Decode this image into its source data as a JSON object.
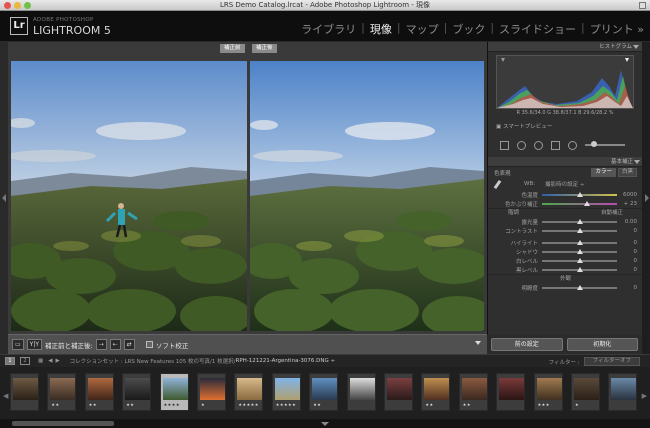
{
  "window": {
    "title": "LRS Demo Catalog.lrcat - Adobe Photoshop Lightroom - 現像"
  },
  "brand": {
    "badge": "Lr",
    "line1": "ADOBE PHOTOSHOP",
    "line2": "LIGHTROOM 5"
  },
  "modules": [
    "ライブラリ",
    "現像",
    "マップ",
    "ブック",
    "スライドショー",
    "プリント »"
  ],
  "active_module": "現像",
  "view": {
    "before_label": "補正前",
    "after_label": "補正後"
  },
  "toolbar": {
    "yy_label": "Y|Y",
    "compare_label": "補正前と補正後:",
    "soft_proof_label": "ソフト校正"
  },
  "histogram": {
    "title": "ヒストグラム",
    "rgb_readout": "R 35.6/34.0  G 38.8/37.1  B 29.6/28.2 %",
    "smart_preview": "スマートプレビュー"
  },
  "basic": {
    "title": "基本補正",
    "treatment_label": "色表現",
    "treatment_options": [
      "カラー",
      "白黒"
    ],
    "wb_label": "WB:",
    "wb_value": "撮影時の設定 ÷",
    "tone_label": "階調",
    "auto_label": "自動補正",
    "presence_label": "外観",
    "sliders_wb": [
      {
        "label": "色温度",
        "value": "6000",
        "pos": 0.5,
        "color": "linear-gradient(90deg,#2f5fa8,#d2c04a)"
      },
      {
        "label": "色かぶり補正",
        "value": "+ 23",
        "pos": 0.6,
        "color": "linear-gradient(90deg,#4ea84a,#b94ab0)"
      }
    ],
    "sliders_tone": [
      {
        "label": "露光量",
        "value": "0.00",
        "pos": 0.5
      },
      {
        "label": "コントラスト",
        "value": "0",
        "pos": 0.5
      }
    ],
    "sliders_tone2": [
      {
        "label": "ハイライト",
        "value": "0",
        "pos": 0.5
      },
      {
        "label": "シャドウ",
        "value": "0",
        "pos": 0.5
      },
      {
        "label": "白レベル",
        "value": "0",
        "pos": 0.5
      },
      {
        "label": "黒レベル",
        "value": "0",
        "pos": 0.5
      }
    ],
    "sliders_presence": [
      {
        "label": "明瞭度",
        "value": "0",
        "pos": 0.5
      }
    ]
  },
  "panel_buttons": {
    "previous": "前の設定",
    "reset": "初期化"
  },
  "filmstrip_bar": {
    "page1": "1",
    "page2": "2",
    "collection_path": "コレクションセット : LRS New Features  105 枚の写真/1 枚選択/",
    "filename": "RPH-121221-Argentina-3076.DNG ÷",
    "filter_label": "フィルター :",
    "filter_value": "フィルターオフ"
  },
  "thumbnails": [
    {
      "stars": "",
      "c1": "#6d5a43",
      "c2": "#2a2118"
    },
    {
      "stars": "★★",
      "c1": "#8a6a52",
      "c2": "#3a2c22"
    },
    {
      "stars": "★★",
      "c1": "#b06a40",
      "c2": "#402418"
    },
    {
      "stars": "★★",
      "c1": "#4c4c4c",
      "c2": "#1a1a1a"
    },
    {
      "stars": "★★★★",
      "c1": "#8fb3d8",
      "c2": "#3f5a2e",
      "selected": true
    },
    {
      "stars": "★",
      "c1": "#2a2a3a",
      "c2": "#e07030"
    },
    {
      "stars": "★★★★★",
      "c1": "#d7b98a",
      "c2": "#8a6a40"
    },
    {
      "stars": "★★★★★",
      "c1": "#7fb4e8",
      "c2": "#b0a070"
    },
    {
      "stars": "★★",
      "c1": "#5f8fc0",
      "c2": "#2a3a50"
    },
    {
      "stars": "",
      "c1": "#ddd",
      "c2": "#444"
    },
    {
      "stars": "",
      "c1": "#7b4040",
      "c2": "#2a1a1a"
    },
    {
      "stars": "★★",
      "c1": "#c09050",
      "c2": "#503020"
    },
    {
      "stars": "★★",
      "c1": "#8a5a40",
      "c2": "#3a2820"
    },
    {
      "stars": "",
      "c1": "#7a3a3a",
      "c2": "#2a1414"
    },
    {
      "stars": "★★★",
      "c1": "#a07a50",
      "c2": "#403020"
    },
    {
      "stars": "★",
      "c1": "#5a4a3a",
      "c2": "#2a2018"
    },
    {
      "stars": "",
      "c1": "#6a8aa8",
      "c2": "#2a3240"
    }
  ]
}
